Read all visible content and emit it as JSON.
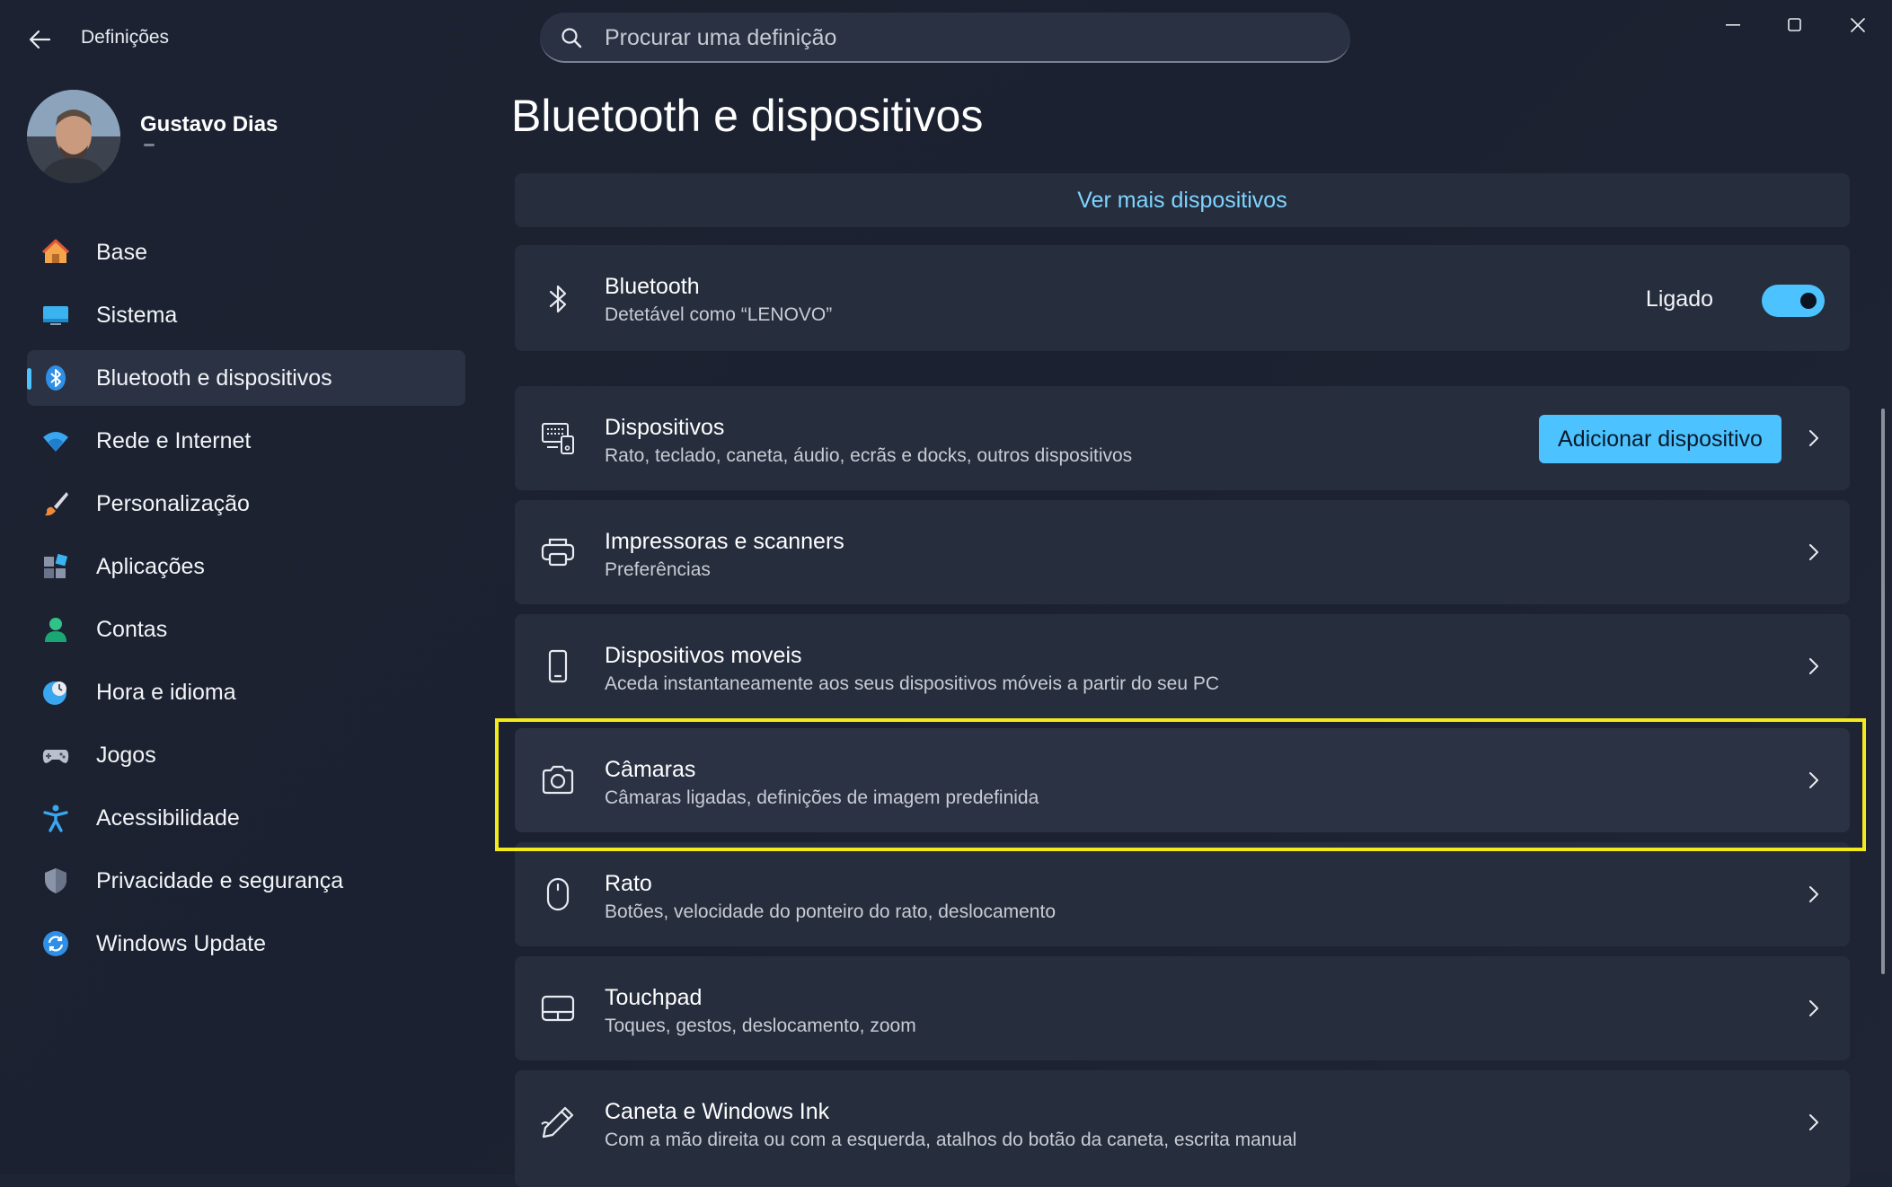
{
  "window": {
    "app_title": "Definições",
    "search_placeholder": "Procurar uma definição"
  },
  "profile": {
    "name": "Gustavo Dias"
  },
  "sidebar": {
    "items": [
      {
        "label": "Base",
        "icon": "home-icon",
        "active": false
      },
      {
        "label": "Sistema",
        "icon": "monitor-icon",
        "active": false
      },
      {
        "label": "Bluetooth e dispositivos",
        "icon": "bluetooth-icon",
        "active": true
      },
      {
        "label": "Rede e Internet",
        "icon": "wifi-icon",
        "active": false
      },
      {
        "label": "Personalização",
        "icon": "paintbrush-icon",
        "active": false
      },
      {
        "label": "Aplicações",
        "icon": "apps-icon",
        "active": false
      },
      {
        "label": "Contas",
        "icon": "person-icon",
        "active": false
      },
      {
        "label": "Hora e idioma",
        "icon": "clock-globe-icon",
        "active": false
      },
      {
        "label": "Jogos",
        "icon": "gamepad-icon",
        "active": false
      },
      {
        "label": "Acessibilidade",
        "icon": "accessibility-icon",
        "active": false
      },
      {
        "label": "Privacidade e segurança",
        "icon": "shield-icon",
        "active": false
      },
      {
        "label": "Windows Update",
        "icon": "refresh-icon",
        "active": false
      }
    ]
  },
  "main": {
    "title": "Bluetooth e dispositivos",
    "more_devices_link": "Ver mais dispositivos",
    "bluetooth": {
      "title": "Bluetooth",
      "subtitle": "Detetável como “LENOVO”",
      "state_label": "Ligado",
      "on": true
    },
    "add_device_button": "Adicionar dispositivo",
    "rows": [
      {
        "title": "Dispositivos",
        "subtitle": "Rato, teclado, caneta, áudio, ecrãs e docks, outros dispositivos",
        "icon": "devices-icon"
      },
      {
        "title": "Impressoras e scanners",
        "subtitle": "Preferências",
        "icon": "printer-icon"
      },
      {
        "title": "Dispositivos moveis",
        "subtitle": "Aceda instantaneamente aos seus dispositivos móveis a partir do seu PC",
        "icon": "phone-icon"
      },
      {
        "title": "Câmaras",
        "subtitle": "Câmaras ligadas, definições de imagem predefinida",
        "icon": "camera-icon",
        "highlighted": true
      },
      {
        "title": "Rato",
        "subtitle": "Botões, velocidade do ponteiro do rato, deslocamento",
        "icon": "mouse-icon"
      },
      {
        "title": "Touchpad",
        "subtitle": "Toques, gestos, deslocamento, zoom",
        "icon": "touchpad-icon"
      },
      {
        "title": "Caneta e Windows Ink",
        "subtitle": "Com a mão direita ou com a esquerda, atalhos do botão da caneta, escrita manual",
        "icon": "pen-icon"
      }
    ]
  },
  "colors": {
    "accent": "#4cc2ff",
    "highlight_box": "#f2ea1c",
    "link": "#7fd4ff"
  }
}
